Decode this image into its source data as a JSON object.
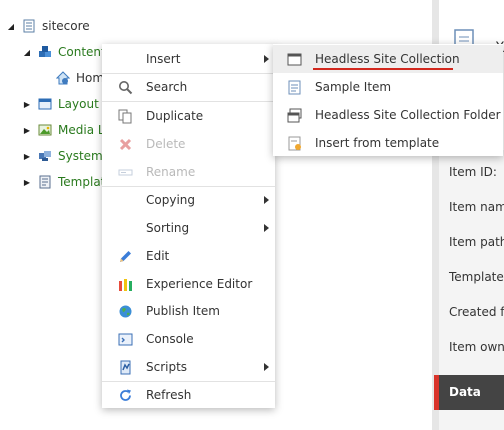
{
  "tree": {
    "root": {
      "label": "sitecore"
    },
    "items": [
      {
        "label": "Content",
        "color": "#2a7a1e"
      },
      {
        "label": "Home",
        "color": "#333333"
      },
      {
        "label": "Layout",
        "color": "#2a7a1e"
      },
      {
        "label": "Media Library",
        "color": "#2a7a1e"
      },
      {
        "label": "System",
        "color": "#2a7a1e"
      },
      {
        "label": "Templates",
        "color": "#2a7a1e"
      }
    ]
  },
  "context_menu": {
    "items": [
      {
        "label": "Insert",
        "icon": "none",
        "submenu": true,
        "disabled": false
      },
      {
        "label": "Search",
        "icon": "search-icon",
        "submenu": false,
        "disabled": false
      },
      {
        "label": "Duplicate",
        "icon": "duplicate-icon",
        "submenu": false,
        "disabled": false
      },
      {
        "label": "Delete",
        "icon": "delete-icon",
        "submenu": false,
        "disabled": true
      },
      {
        "label": "Rename",
        "icon": "rename-icon",
        "submenu": false,
        "disabled": true
      },
      {
        "label": "Copying",
        "icon": "none",
        "submenu": true,
        "disabled": false
      },
      {
        "label": "Sorting",
        "icon": "none",
        "submenu": true,
        "disabled": false
      },
      {
        "label": "Edit",
        "icon": "pencil-icon",
        "submenu": false,
        "disabled": false
      },
      {
        "label": "Experience Editor",
        "icon": "experience-editor-icon",
        "submenu": false,
        "disabled": false
      },
      {
        "label": "Publish Item",
        "icon": "globe-icon",
        "submenu": false,
        "disabled": false
      },
      {
        "label": "Console",
        "icon": "console-icon",
        "submenu": false,
        "disabled": false
      },
      {
        "label": "Scripts",
        "icon": "scripts-icon",
        "submenu": true,
        "disabled": false
      },
      {
        "label": "Refresh",
        "icon": "refresh-icon",
        "submenu": false,
        "disabled": false
      }
    ]
  },
  "insert_submenu": {
    "items": [
      {
        "label": "Headless Site Collection",
        "icon": "window-icon",
        "highlighted": true
      },
      {
        "label": "Sample Item",
        "icon": "document-icon",
        "highlighted": false
      },
      {
        "label": "Headless Site Collection Folder",
        "icon": "folder-window-icon",
        "highlighted": false
      },
      {
        "label": "Insert from template",
        "icon": "template-icon",
        "highlighted": false
      }
    ]
  },
  "right_panel": {
    "header_fragment": "X",
    "fields": [
      "Item ID:",
      "Item name:",
      "Item path:",
      "Template:",
      "Created from:",
      "Item owner:"
    ],
    "section": "Data",
    "accent_color": "#d9342b"
  }
}
